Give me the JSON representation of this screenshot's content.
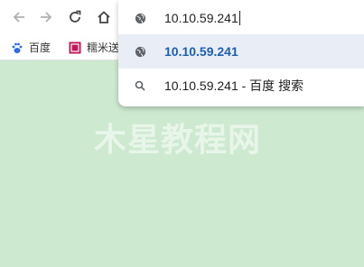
{
  "toolbar": {
    "back_icon": "arrow-left-icon",
    "forward_icon": "arrow-right-icon",
    "reload_icon": "reload-icon",
    "home_icon": "home-icon"
  },
  "bookmarks": {
    "items": [
      {
        "label": "百度",
        "icon": "baidu-paw-icon",
        "color": "#2e6be6"
      },
      {
        "label": "糯米送",
        "icon": "nuomi-icon",
        "color": "#c2185b"
      }
    ]
  },
  "omnibox": {
    "input_value": "10.10.59.241",
    "suggestions": [
      {
        "icon": "globe-icon",
        "text": "10.10.59.241",
        "selected": true
      },
      {
        "icon": "search-icon",
        "text": "10.10.59.241 - 百度 搜索",
        "selected": false
      }
    ]
  },
  "watermark": {
    "text": "木星教程网"
  },
  "colors": {
    "page_background": "#cde9cf",
    "selected_suggestion": "#e9eef6",
    "link_blue": "#1a5fb4"
  }
}
